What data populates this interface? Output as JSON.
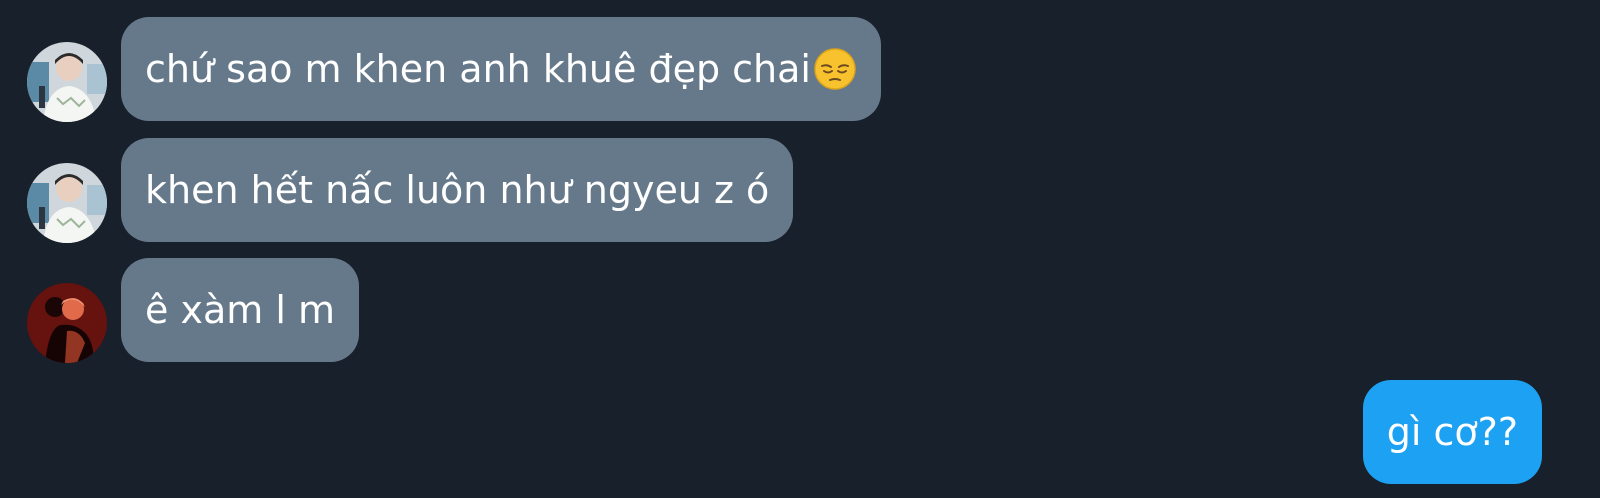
{
  "messages": [
    {
      "sender": "other",
      "text": "chứ sao m khen anh khuê đẹp chai",
      "emoji": "pensive-face"
    },
    {
      "sender": "other",
      "text": "khen hết nấc luôn như ngyeu z ó"
    },
    {
      "sender": "other",
      "text": "ê xàm l m"
    },
    {
      "sender": "self",
      "text": "gì cơ??"
    }
  ],
  "colors": {
    "background": "#18202b",
    "incoming_bubble": "#66798b",
    "outgoing_bubble": "#1da1f2",
    "text": "#ffffff"
  }
}
